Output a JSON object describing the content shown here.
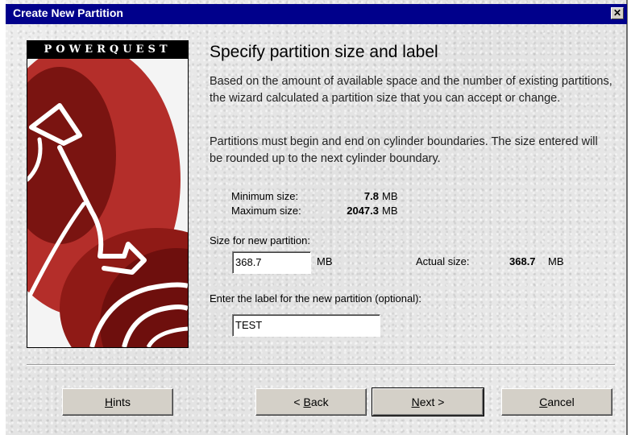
{
  "window": {
    "title": "Create New Partition",
    "close_glyph": "✕"
  },
  "banner": {
    "brand": "POWERQUEST",
    "colors": {
      "red": "#b0231f",
      "dark_red": "#6e0f0d",
      "light": "#ffffff"
    }
  },
  "content": {
    "heading": "Specify partition size and label",
    "para1": "Based on the amount of available space and the number of existing partitions, the wizard calculated a partition size that you can accept or change.",
    "para2": "Partitions must begin and end on cylinder boundaries. The size entered will be rounded up to the next cylinder boundary.",
    "min_label": "Minimum size:",
    "min_value": "7.8",
    "min_unit": "MB",
    "max_label": "Maximum size:",
    "max_value": "2047.3",
    "max_unit": "MB",
    "size_label": "Size for new partition:",
    "size_value": "368.7",
    "size_unit": "MB",
    "actual_label": "Actual size:",
    "actual_value": "368.7",
    "actual_unit": "MB",
    "label_prompt": "Enter the label for the new partition (optional):",
    "label_value": "TEST"
  },
  "buttons": {
    "hints": {
      "mnemonic": "H",
      "rest": "ints"
    },
    "back": {
      "prefix": "< ",
      "mnemonic": "B",
      "rest": "ack"
    },
    "next": {
      "mnemonic": "N",
      "rest": "ext >"
    },
    "cancel": {
      "mnemonic": "C",
      "rest": "ancel"
    }
  }
}
